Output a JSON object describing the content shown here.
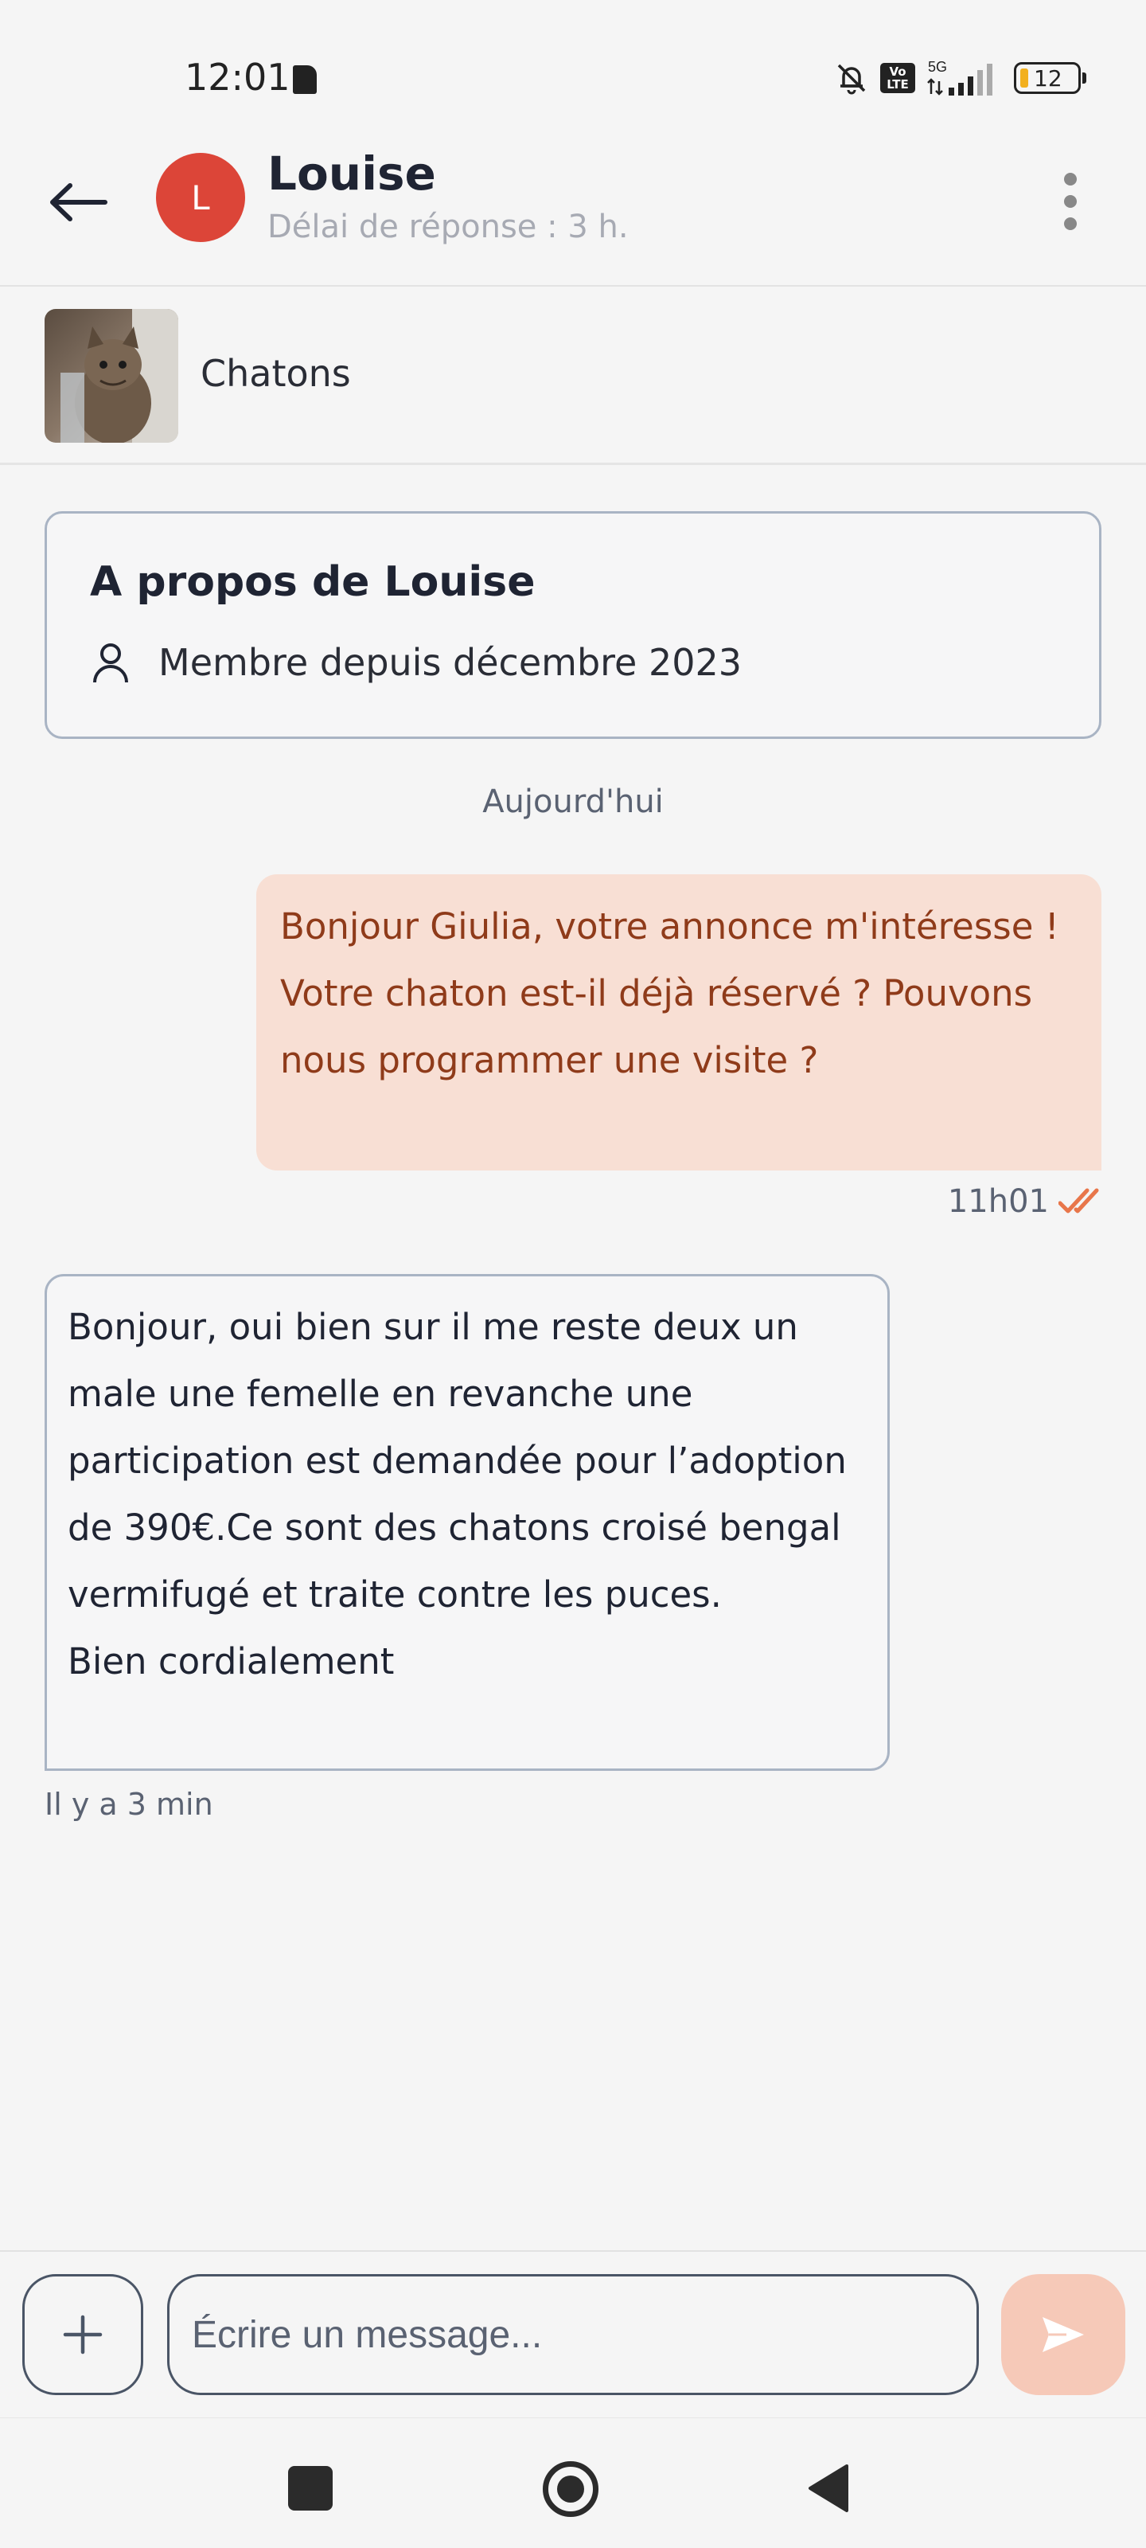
{
  "status_bar": {
    "time": "12:01",
    "network": "5G",
    "volte_line1": "Vo",
    "volte_line2": "LTE",
    "battery": "12",
    "icons": [
      "sim-icon",
      "bell-off-icon",
      "volte-icon",
      "signal-icon",
      "battery-icon"
    ]
  },
  "header": {
    "avatar_letter": "L",
    "avatar_color": "#dc4538",
    "name": "Louise",
    "response_time": "Délai de réponse : 3 h."
  },
  "listing": {
    "title": "Chatons"
  },
  "about": {
    "title": "A propos de Louise",
    "member_since": "Membre depuis décembre 2023"
  },
  "conversation": {
    "day_label": "Aujourd'hui",
    "outgoing": {
      "text": "Bonjour Giulia, votre annonce m'intéresse ! Votre chaton est-il déjà réservé ? Pouvons nous programmer une visite ?",
      "time": "11h01",
      "status": "read"
    },
    "incoming": {
      "text": "Bonjour, oui bien sur il me reste deux un male une femelle en revanche une participation est demandée pour l’adoption de 390€.Ce sont des chatons croisé bengal vermifugé et traite contre les puces.\nBien cordialement",
      "time": "Il y a 3 min"
    }
  },
  "composer": {
    "placeholder": "Écrire un message..."
  },
  "colors": {
    "accent": "#e8764a",
    "outgoing_bubble": "#f8dfd4",
    "outgoing_text": "#8f3b1a",
    "send_button": "#f6c9b8"
  }
}
